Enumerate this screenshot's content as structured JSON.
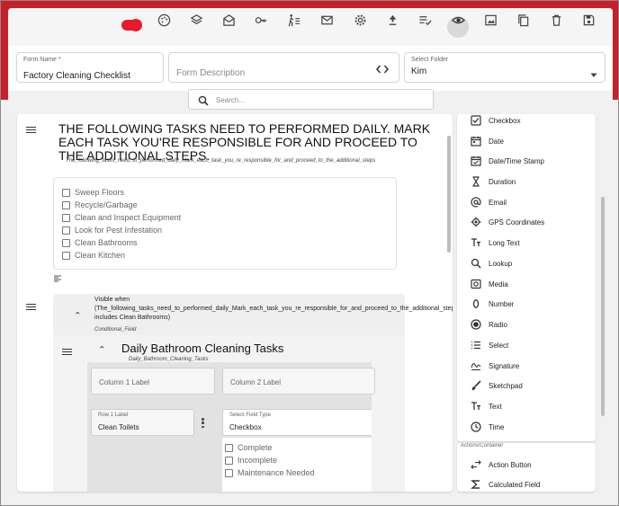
{
  "toolbar": {
    "icons": [
      "toggle-switch",
      "palette-icon",
      "layers-icon",
      "mail-open-icon",
      "key-icon",
      "walk-list-icon",
      "mail-icon",
      "gear-icon",
      "arrow-up-icon",
      "checklist-icon",
      "eye-icon",
      "image-icon",
      "copy-icon",
      "trash-icon",
      "save-icon"
    ],
    "accent": "#e8192c",
    "band_color": "#c8202a"
  },
  "form": {
    "name_label": "Form Name *",
    "name_value": "Factory Cleaning Checklist",
    "description_placeholder": "Form Description",
    "folder_label": "Select Folder",
    "folder_value": "Kim"
  },
  "search": {
    "placeholder": "Search..."
  },
  "canvas": {
    "heading": "THE FOLLOWING TASKS NEED TO PERFORMED DAILY. MARK EACH TASK YOU'RE RESPONSIBLE FOR AND PROCEED TO THE ADDITIONAL STEPS.",
    "heading_var": "The_following_tasks_need_to_performed_daily_Mark_each_task_you_re_responsible_for_and_proceed_to_the_additional_steps",
    "checklist": [
      "Sweep Floors",
      "Recycle/Garbage",
      "Clean and Inspect Equipment",
      "Look for Pest Infestation",
      "Clean Bathrooms",
      "Clean Kitchen"
    ],
    "condition_text": "Visible when (The_following_tasks_need_to_performed_daily_Mark_each_task_you_re_responsible_for_and_proceed_to_the_additional_steps includes Clean Bathrooms)",
    "condition_var": "Conditional_Field",
    "section_title": "Daily Bathroom Cleaning Tasks",
    "section_var": "Daily_Bathroom_Cleaning_Tasks",
    "column1": "Column 1 Label",
    "column2": "Column 2 Label",
    "row_label_caption": "Row 1 Label",
    "row_label_value": "Clean Toilets",
    "field_type_caption": "Select Field Type",
    "field_type_value": "Checkbox",
    "options": [
      "Complete",
      "Incomplete",
      "Maintenance Needed"
    ]
  },
  "palette": {
    "items": [
      {
        "label": "Checkbox",
        "icon": "checkbox-icon"
      },
      {
        "label": "Date",
        "icon": "calendar-icon"
      },
      {
        "label": "Date/Time Stamp",
        "icon": "calendar-check-icon"
      },
      {
        "label": "Duration",
        "icon": "hourglass-icon"
      },
      {
        "label": "Email",
        "icon": "at-icon"
      },
      {
        "label": "GPS Coordinates",
        "icon": "crosshair-icon"
      },
      {
        "label": "Long Text",
        "icon": "text-size-icon"
      },
      {
        "label": "Lookup",
        "icon": "magnifier-icon"
      },
      {
        "label": "Media",
        "icon": "camera-icon"
      },
      {
        "label": "Number",
        "icon": "zero-icon"
      },
      {
        "label": "Radio",
        "icon": "radio-icon"
      },
      {
        "label": "Select",
        "icon": "list-icon"
      },
      {
        "label": "Signature",
        "icon": "signature-icon"
      },
      {
        "label": "Sketchpad",
        "icon": "brush-icon"
      },
      {
        "label": "Text",
        "icon": "text-icon"
      },
      {
        "label": "Time",
        "icon": "clock-icon"
      }
    ],
    "section2_label": "Actions/Container",
    "items2": [
      {
        "label": "Action Button",
        "icon": "action-arrows-icon"
      },
      {
        "label": "Calculated Field",
        "icon": "sigma-icon"
      }
    ]
  }
}
